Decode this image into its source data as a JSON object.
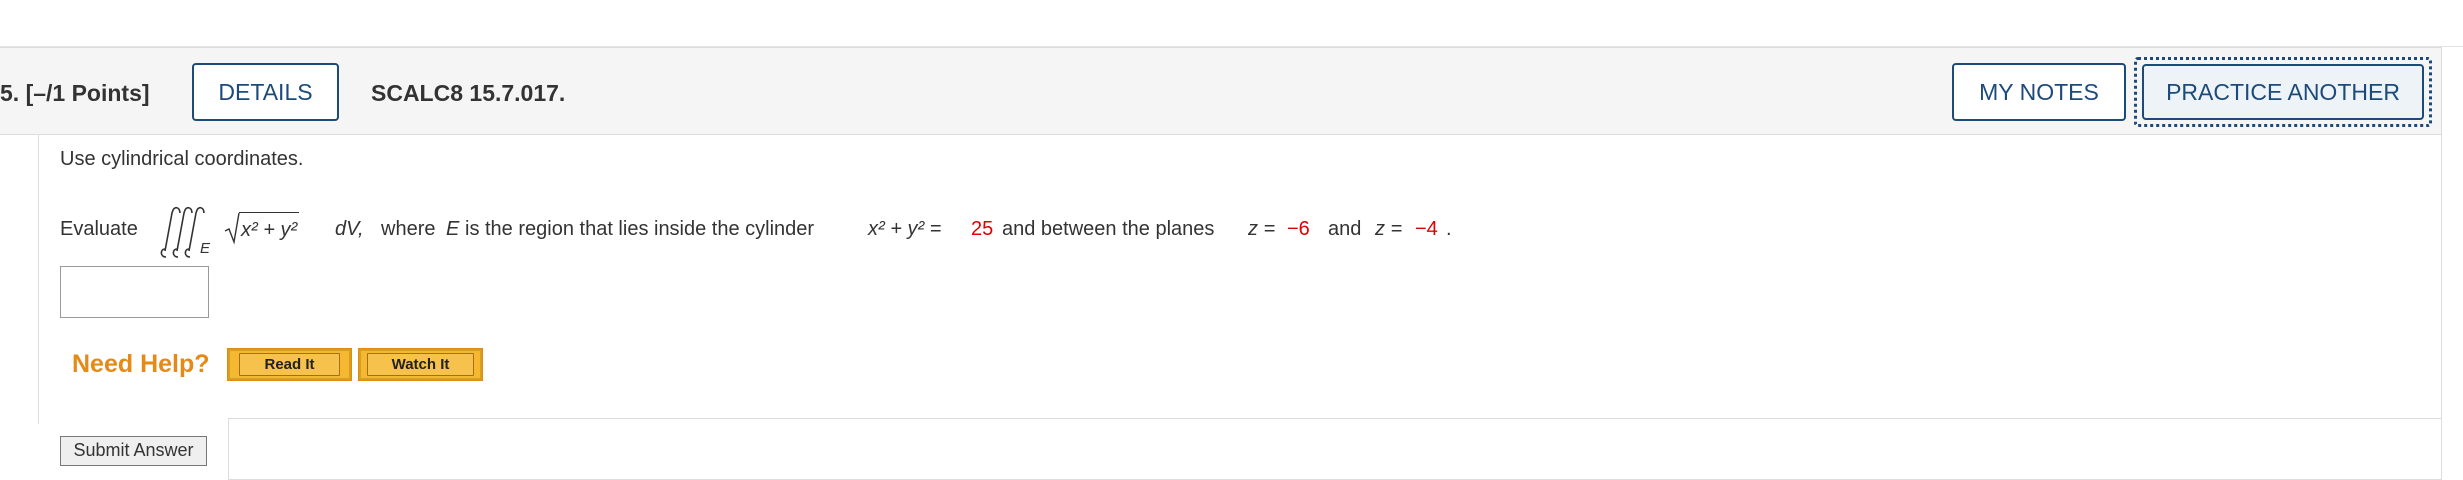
{
  "header": {
    "points": "5. [–/1 Points]",
    "details_label": "DETAILS",
    "problem_code": "SCALC8 15.7.017.",
    "my_notes_label": "MY NOTES",
    "practice_label": "PRACTICE ANOTHER"
  },
  "question": {
    "instruction": "Use cylindrical coordinates.",
    "evaluate_label": "Evaluate",
    "integral_subscript": "E",
    "integrand": "x² + y²",
    "dv": "dV,",
    "where_text": "where",
    "region_var": "E",
    "region_text": "is the region that lies inside the cylinder",
    "cylinder_lhs": "x² + y² =",
    "radius_sq": "25",
    "between_text": "and between the planes",
    "plane1_lhs": "z =",
    "plane1_val": "−6",
    "and_text": "and",
    "plane2_lhs": "z =",
    "plane2_val": "−4",
    "period": "."
  },
  "answer": {
    "value": ""
  },
  "help": {
    "need_help_label": "Need Help?",
    "read_it_label": "Read It",
    "watch_it_label": "Watch It"
  },
  "submit": {
    "label": "Submit Answer"
  },
  "colors": {
    "accent": "#1c4a7a",
    "help_orange": "#e58a17",
    "given_red": "#e00000",
    "button_yellow": "#f6b731"
  }
}
